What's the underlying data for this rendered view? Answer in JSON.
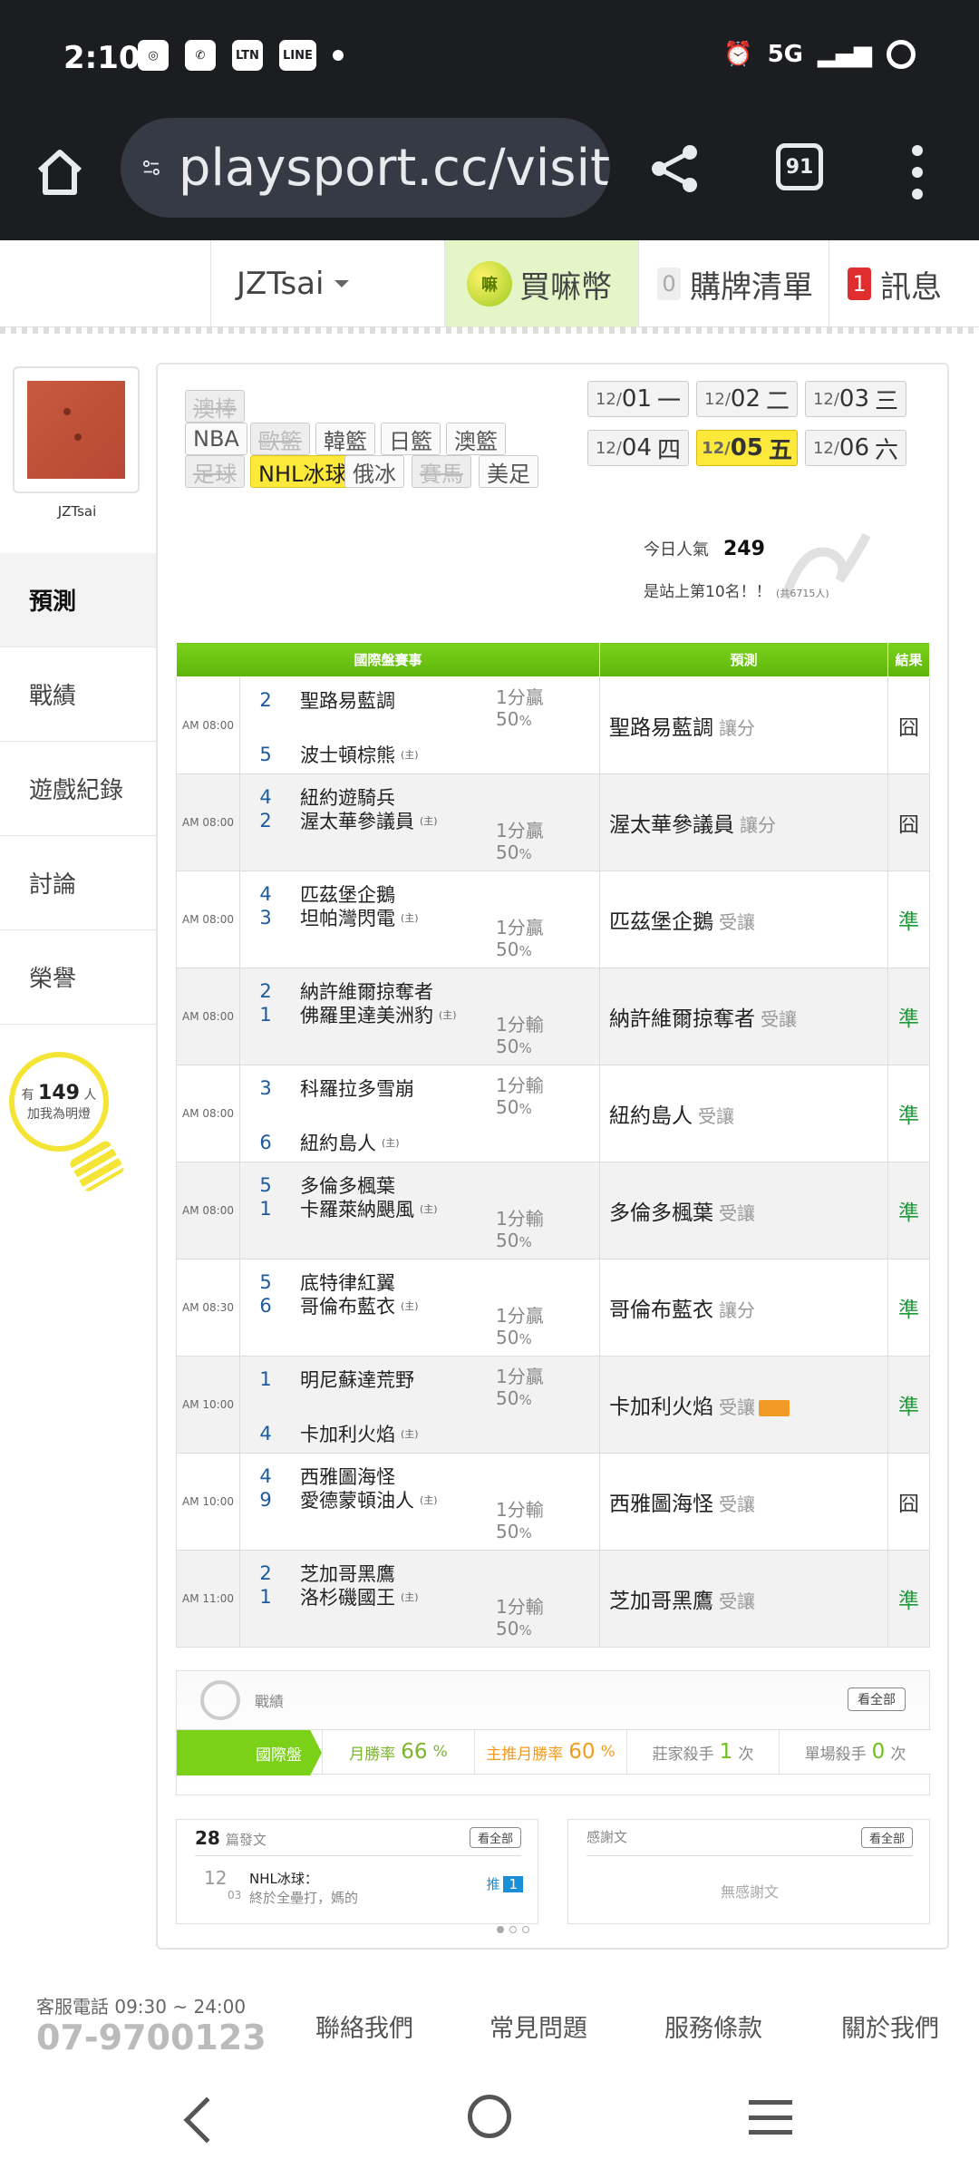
{
  "status": {
    "time": "2:10",
    "apps": [
      "LTN",
      "LINE"
    ],
    "network": "5G"
  },
  "browser": {
    "url": "playsport.cc/visit",
    "tab_count": "91"
  },
  "topbar": {
    "user": "JZTsai",
    "buy_coin": "買嘛幣",
    "coin_icon_text": "嘛",
    "cart_label": "購牌清單",
    "cart_count": "0",
    "msg_label": "訊息",
    "msg_count": "1"
  },
  "profile": {
    "username": "JZTsai",
    "nav": [
      "預測",
      "戰績",
      "遊戲紀錄",
      "討論",
      "榮譽"
    ],
    "lamp_pre": "有",
    "lamp_count": "149",
    "lamp_unit": "人",
    "lamp_text": "加我為明燈"
  },
  "sports": [
    {
      "label": "澳棒",
      "state": "dim"
    },
    {
      "label": "NBA",
      "state": "normal"
    },
    {
      "label": "歐籃",
      "state": "dim"
    },
    {
      "label": "韓籃",
      "state": "normal"
    },
    {
      "label": "日籃",
      "state": "normal"
    },
    {
      "label": "澳籃",
      "state": "normal"
    },
    {
      "label": "足球",
      "state": "dim"
    },
    {
      "label": "NHL冰球",
      "state": "on"
    },
    {
      "label": "俄冰",
      "state": "normal"
    },
    {
      "label": "賽馬",
      "state": "dim"
    },
    {
      "label": "美足",
      "state": "normal"
    }
  ],
  "dates": [
    {
      "md": "12/",
      "d": "01",
      "w": "一",
      "active": false
    },
    {
      "md": "12/",
      "d": "02",
      "w": "二",
      "active": false
    },
    {
      "md": "12/",
      "d": "03",
      "w": "三",
      "active": false
    },
    {
      "md": "12/",
      "d": "04",
      "w": "四",
      "active": false
    },
    {
      "md": "12/",
      "d": "05",
      "w": "五",
      "active": true
    },
    {
      "md": "12/",
      "d": "06",
      "w": "六",
      "active": false
    }
  ],
  "popularity": {
    "label": "今日人氣",
    "value": "249",
    "rank": "是站上第10名！！",
    "rank_note": "(共6715人)"
  },
  "table": {
    "headers": [
      "國際盤賽事",
      "預測",
      "結果"
    ],
    "home_mark": "(主)",
    "rows": [
      {
        "time": "AM 08:00",
        "a_num": "2",
        "a_team": "聖路易藍調",
        "b_num": "5",
        "b_team": "波士頓棕熊",
        "odds": "1分贏",
        "pct": "50",
        "odds_pos": "top",
        "pick": "聖路易藍調",
        "pick_type": "讓分",
        "tag": false,
        "result": "囧",
        "ok": false
      },
      {
        "time": "AM 08:00",
        "a_num": "4",
        "a_team": "紐約遊騎兵",
        "b_num": "2",
        "b_team": "渥太華參議員",
        "odds": "1分贏",
        "pct": "50",
        "odds_pos": "bottom",
        "pick": "渥太華參議員",
        "pick_type": "讓分",
        "tag": false,
        "result": "囧",
        "ok": false
      },
      {
        "time": "AM 08:00",
        "a_num": "4",
        "a_team": "匹茲堡企鵝",
        "b_num": "3",
        "b_team": "坦帕灣閃電",
        "odds": "1分贏",
        "pct": "50",
        "odds_pos": "bottom",
        "pick": "匹茲堡企鵝",
        "pick_type": "受讓",
        "tag": false,
        "result": "準",
        "ok": true
      },
      {
        "time": "AM 08:00",
        "a_num": "2",
        "a_team": "納許維爾掠奪者",
        "b_num": "1",
        "b_team": "佛羅里達美洲豹",
        "odds": "1分輸",
        "pct": "50",
        "odds_pos": "bottom",
        "pick": "納許維爾掠奪者",
        "pick_type": "受讓",
        "tag": false,
        "result": "準",
        "ok": true
      },
      {
        "time": "AM 08:00",
        "a_num": "3",
        "a_team": "科羅拉多雪崩",
        "b_num": "6",
        "b_team": "紐約島人",
        "odds": "1分輸",
        "pct": "50",
        "odds_pos": "top",
        "pick": "紐約島人",
        "pick_type": "受讓",
        "tag": false,
        "result": "準",
        "ok": true
      },
      {
        "time": "AM 08:00",
        "a_num": "5",
        "a_team": "多倫多楓葉",
        "b_num": "1",
        "b_team": "卡羅萊納颶風",
        "odds": "1分輸",
        "pct": "50",
        "odds_pos": "bottom",
        "pick": "多倫多楓葉",
        "pick_type": "受讓",
        "tag": false,
        "result": "準",
        "ok": true
      },
      {
        "time": "AM 08:30",
        "a_num": "5",
        "a_team": "底特律紅翼",
        "b_num": "6",
        "b_team": "哥倫布藍衣",
        "odds": "1分贏",
        "pct": "50",
        "odds_pos": "bottom",
        "pick": "哥倫布藍衣",
        "pick_type": "讓分",
        "tag": false,
        "result": "準",
        "ok": true
      },
      {
        "time": "AM 10:00",
        "a_num": "1",
        "a_team": "明尼蘇達荒野",
        "b_num": "4",
        "b_team": "卡加利火焰",
        "odds": "1分贏",
        "pct": "50",
        "odds_pos": "top",
        "pick": "卡加利火焰",
        "pick_type": "受讓",
        "tag": true,
        "result": "準",
        "ok": true
      },
      {
        "time": "AM 10:00",
        "a_num": "4",
        "a_team": "西雅圖海怪",
        "b_num": "9",
        "b_team": "愛德蒙頓油人",
        "odds": "1分輸",
        "pct": "50",
        "odds_pos": "bottom",
        "pick": "西雅圖海怪",
        "pick_type": "受讓",
        "tag": false,
        "result": "囧",
        "ok": false
      },
      {
        "time": "AM 11:00",
        "a_num": "2",
        "a_team": "芝加哥黑鷹",
        "b_num": "1",
        "b_team": "洛杉磯國王",
        "odds": "1分輸",
        "pct": "50",
        "odds_pos": "bottom",
        "pick": "芝加哥黑鷹",
        "pick_type": "受讓",
        "tag": false,
        "result": "準",
        "ok": true
      }
    ]
  },
  "record": {
    "title": "戰績",
    "see_all": "看全部",
    "tab": "國際盤",
    "month_rate_label": "月勝率",
    "month_rate": "66",
    "main_rate_label": "主推月勝率",
    "main_rate": "60",
    "pct": "%",
    "banker_label": "莊家殺手",
    "banker": "1",
    "single_label": "單場殺手",
    "single": "0",
    "times": "次"
  },
  "posts": {
    "count": "28",
    "label": "篇發文",
    "see_all": "看全部",
    "date_m": "12",
    "date_d": "03",
    "title": "NHL冰球：",
    "excerpt": "終於全壘打，媽的",
    "push": "推",
    "push_count": "1"
  },
  "thanks": {
    "label": "感謝文",
    "see_all": "看全部",
    "empty": "無感謝文"
  },
  "footer": {
    "service": "客服電話 09:30 ~ 24:00",
    "phone": "07-9700123",
    "links": [
      "聯絡我們",
      "常見問題",
      "服務條款",
      "關於我們"
    ]
  }
}
